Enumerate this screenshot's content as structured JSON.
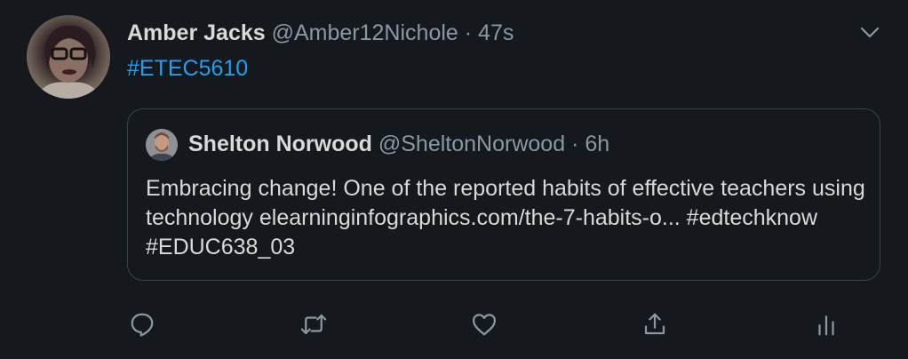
{
  "tweet": {
    "author_name": "Amber Jacks",
    "author_handle": "@Amber12Nichole",
    "separator": "·",
    "time": "47s",
    "text": "#ETEC5610"
  },
  "quoted_tweet": {
    "author_name": "Shelton Norwood",
    "author_handle": "@SheltonNorwood",
    "separator": "·",
    "time": "6h",
    "text": "Embracing change! One of the reported habits of effective teachers using technology elearninginfographics.com/the-7-habits-o... #edtechknow #EDUC638_03"
  },
  "actions": [
    {
      "icon": "reply-icon"
    },
    {
      "icon": "retweet-icon"
    },
    {
      "icon": "like-icon"
    },
    {
      "icon": "share-icon"
    },
    {
      "icon": "analytics-icon"
    }
  ],
  "colors": {
    "background": "#15181c",
    "text": "#d9d9d9",
    "muted": "#8899a6",
    "accent": "#1da1f2",
    "border": "#38444d"
  }
}
